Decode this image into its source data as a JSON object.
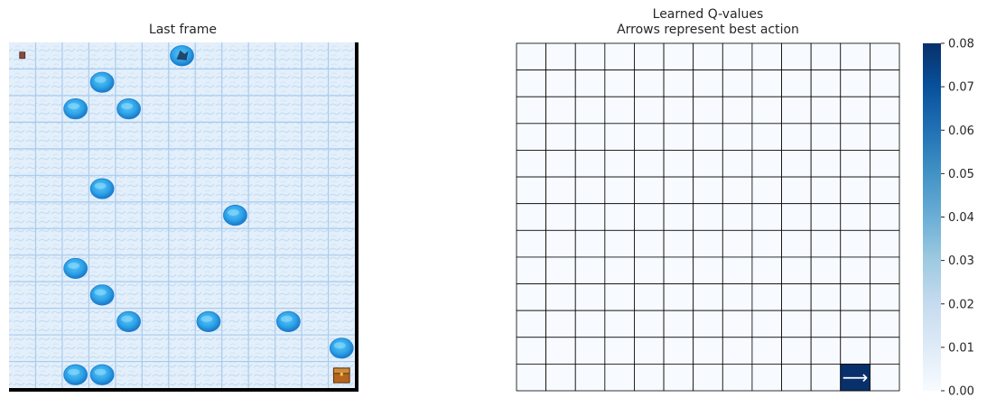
{
  "left_panel": {
    "title": "Last frame",
    "grid_size": 13,
    "start_cell": [
      0,
      0
    ],
    "player_cell": [
      0,
      6
    ],
    "goal_cell": [
      12,
      12
    ],
    "holes": [
      [
        1,
        3
      ],
      [
        2,
        2
      ],
      [
        2,
        4
      ],
      [
        5,
        3
      ],
      [
        6,
        8
      ],
      [
        8,
        2
      ],
      [
        9,
        3
      ],
      [
        10,
        4
      ],
      [
        10,
        7
      ],
      [
        10,
        10
      ],
      [
        11,
        12
      ],
      [
        12,
        2
      ],
      [
        12,
        3
      ]
    ],
    "colors": {
      "ice": "#dcecf8",
      "ice_line": "#a9cbef",
      "hole": "#33a9ec",
      "hole_dark": "#1b7fd0",
      "border": "#000000"
    }
  },
  "chart_data": {
    "type": "heatmap",
    "title": "Learned Q-values",
    "subtitle": "Arrows represent best action",
    "rows": 13,
    "cols": 13,
    "nonzero_cells": [
      {
        "row": 12,
        "col": 11,
        "value": 0.08,
        "arrow": "⟶"
      }
    ],
    "colorbar": {
      "min": 0.0,
      "max": 0.08,
      "ticks": [
        "0.00",
        "0.01",
        "0.02",
        "0.03",
        "0.04",
        "0.05",
        "0.06",
        "0.07",
        "0.08"
      ],
      "low_color": "#f7fbff",
      "high_color": "#08306b"
    }
  }
}
